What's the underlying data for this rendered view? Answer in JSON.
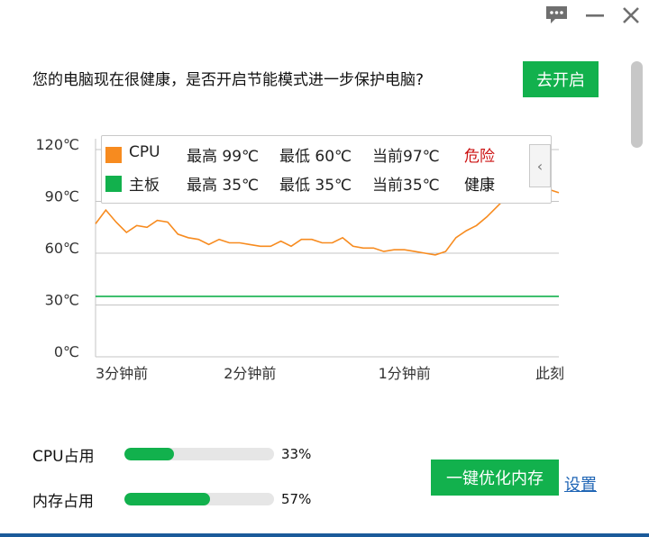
{
  "prompt": {
    "text": "您的电脑现在很健康，是否开启节能模式进一步保护电脑?",
    "button_label": "去开启"
  },
  "legend": {
    "rows": [
      {
        "name": "CPU",
        "max": "最高 99℃",
        "min": "最低 60℃",
        "current": "当前97℃",
        "status": "危险",
        "color": "#f78b1f",
        "status_color": "#cc1111"
      },
      {
        "name": "主板",
        "max": "最高 35℃",
        "min": "最低 35℃",
        "current": "当前35℃",
        "status": "健康",
        "color": "#12b14d",
        "status_color": "#111111"
      }
    ],
    "toggle_icon": "chevron-left-icon"
  },
  "chart_data": {
    "type": "line",
    "x_ticks": [
      "3分钟前",
      "2分钟前",
      "1分钟前",
      "此刻"
    ],
    "y_ticks": [
      "0℃",
      "30℃",
      "60℃",
      "90℃",
      "120℃"
    ],
    "ylim": [
      0,
      120
    ],
    "grid": true,
    "legend_position": "top-right",
    "series": [
      {
        "name": "CPU",
        "color": "#f78b1f",
        "values": [
          77,
          85,
          78,
          72,
          76,
          75,
          79,
          78,
          71,
          69,
          68,
          65,
          68,
          66,
          66,
          65,
          64,
          64,
          67,
          64,
          68,
          68,
          66,
          66,
          69,
          64,
          63,
          63,
          61,
          62,
          62,
          61,
          60,
          59,
          61,
          69,
          73,
          76,
          81,
          87,
          93,
          96,
          97,
          98,
          97,
          95
        ]
      },
      {
        "name": "主板",
        "color": "#12b14d",
        "values": [
          35,
          35
        ]
      }
    ]
  },
  "usage": {
    "cpu": {
      "label": "CPU占用",
      "percent": "33%",
      "value": 33
    },
    "memory": {
      "label": "内存占用",
      "percent": "57%",
      "value": 57
    }
  },
  "actions": {
    "optimize_label": "一键优化内存",
    "settings_label": "设置"
  }
}
